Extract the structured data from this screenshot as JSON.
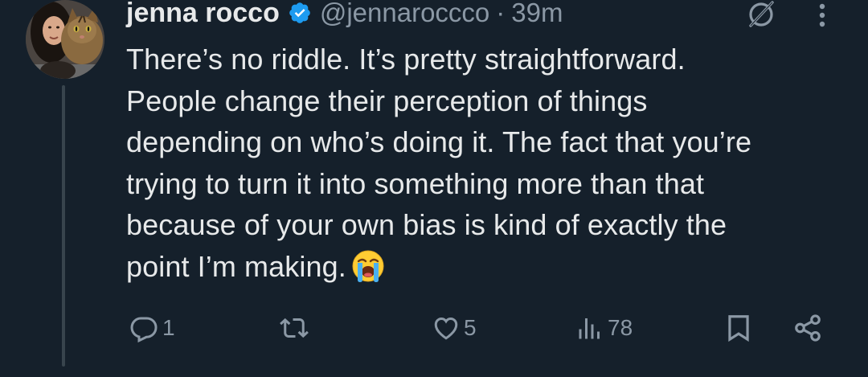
{
  "tweet": {
    "display_name": "jenna rocco",
    "handle": "@jennaroccco",
    "separator": "·",
    "time": "39m",
    "body_lines": [
      "There’s no riddle. It’s pretty straightforward.",
      "People change their perception of things",
      "depending on who’s doing it. The fact that you’re",
      "trying to turn it into something more than that",
      "because of your own bias is kind of exactly the",
      "point I’m making."
    ],
    "emoji": "loudly-crying-face"
  },
  "actions": {
    "reply_count": "1",
    "retweet_count": "",
    "like_count": "5",
    "views_count": "78"
  },
  "colors": {
    "background": "#15202b",
    "text": "#e7e9ea",
    "muted": "#8b98a5",
    "verified": "#1d9bf0"
  },
  "icons": [
    "grok-icon",
    "more-icon",
    "verified-badge-icon",
    "reply-icon",
    "retweet-icon",
    "like-icon",
    "views-icon",
    "bookmark-icon",
    "share-icon"
  ]
}
